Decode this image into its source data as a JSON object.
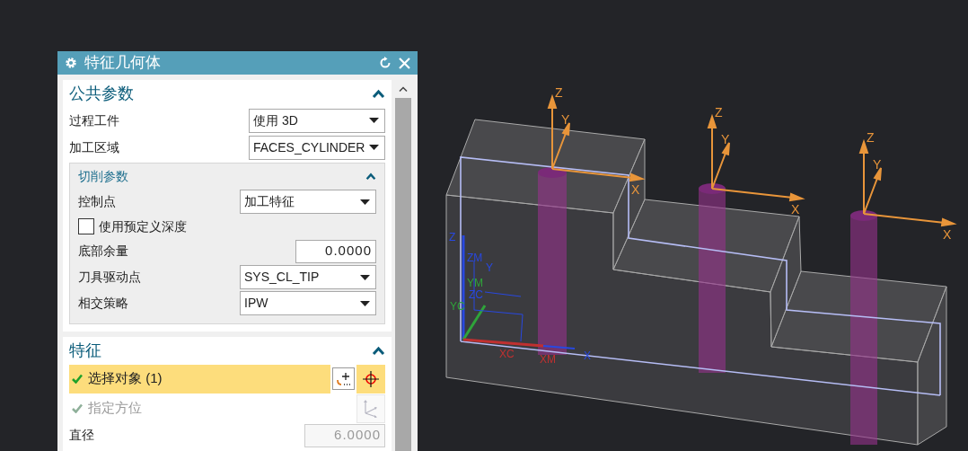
{
  "dialog": {
    "title": "特征几何体",
    "common": {
      "title": "公共参数",
      "expanded": true,
      "rows": [
        {
          "label": "过程工件",
          "value": "使用 3D"
        },
        {
          "label": "加工区域",
          "value": "FACES_CYLINDER"
        }
      ]
    },
    "cutting": {
      "title": "切削参数",
      "expanded": true,
      "rows": [
        {
          "kind": "dropdown",
          "label": "控制点",
          "value": "加工特征"
        },
        {
          "kind": "checkbox",
          "label": "使用预定义深度",
          "checked": false
        },
        {
          "kind": "number",
          "label": "底部余量",
          "value": "0.0000"
        },
        {
          "kind": "dropdown",
          "label": "刀具驱动点",
          "value": "SYS_CL_TIP"
        },
        {
          "kind": "dropdown",
          "label": "相交策略",
          "value": "IPW"
        }
      ]
    },
    "features": {
      "title": "特征",
      "expanded": true,
      "selectors": [
        {
          "label": "选择对象 (1)",
          "active": true,
          "disabled": false
        },
        {
          "label": "指定方位",
          "active": false,
          "disabled": true
        }
      ],
      "diameter": {
        "label": "直径",
        "value": "6.0000",
        "disabled": true
      }
    }
  },
  "viewport": {
    "feature_csys": [
      {
        "z": "Z",
        "y": "Y",
        "x": "X"
      },
      {
        "z": "Z",
        "y": "Y",
        "x": "X"
      },
      {
        "z": "Z",
        "y": "Y",
        "x": "X"
      }
    ],
    "wcs_labels": [
      "Z",
      "ZM",
      "Y",
      "YM",
      "ZC",
      "YC",
      "XC",
      "XM",
      "X"
    ]
  }
}
